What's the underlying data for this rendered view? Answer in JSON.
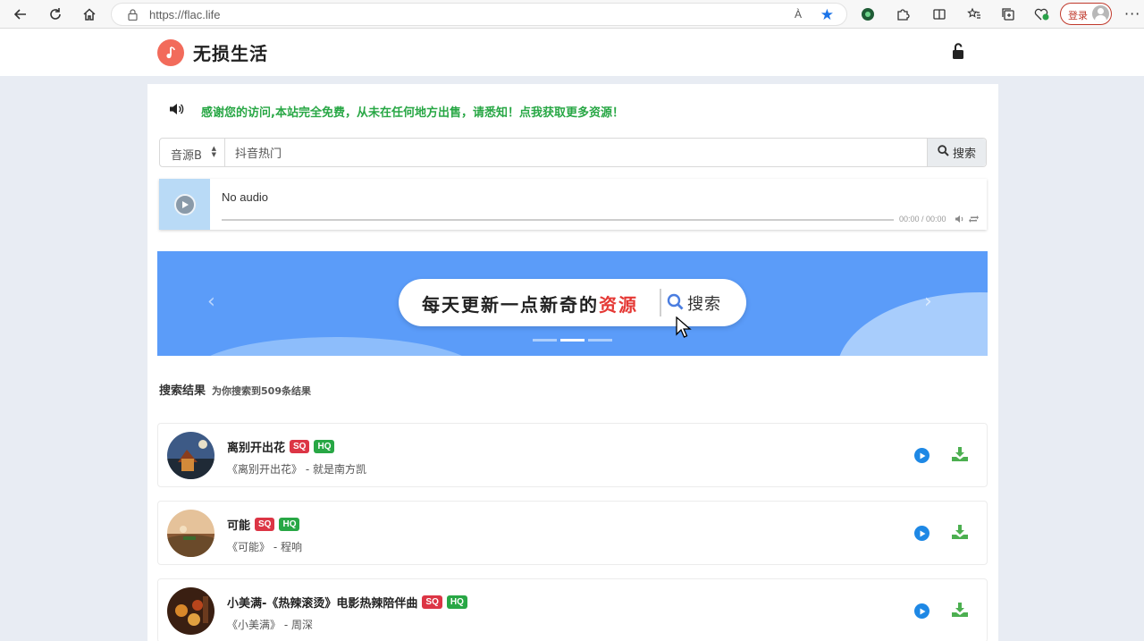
{
  "browser": {
    "url": "https://flac.life",
    "read_aloud": "À",
    "login_label": "登录"
  },
  "site": {
    "name": "无损生活"
  },
  "notice": "感谢您的访问,本站完全免费，从未在任何地方出售，请悉知！点我获取更多资源！",
  "search": {
    "source": "音源B",
    "query": "抖音热门",
    "button": "搜索"
  },
  "player": {
    "title": "No audio",
    "time": "00:00 / 00:00"
  },
  "banner": {
    "slogan_main": "每天更新一点新奇的",
    "slogan_highlight": "资源",
    "search_label": "搜索",
    "prev": "‹",
    "next": "›",
    "active_slide": 2
  },
  "results": {
    "title": "搜索结果",
    "summary": "为你搜索到509条结果",
    "items": [
      {
        "title": "离别开出花",
        "badges": [
          "SQ",
          "HQ"
        ],
        "subtitle": "《离别开出花》 - 就是南方凯"
      },
      {
        "title": "可能",
        "badges": [
          "SQ",
          "HQ"
        ],
        "subtitle": "《可能》 - 程响"
      },
      {
        "title": "小美满-《热辣滚烫》电影热辣陪伴曲",
        "badges": [
          "SQ",
          "HQ"
        ],
        "subtitle": "《小美满》 - 周深"
      }
    ]
  },
  "colors": {
    "accent_green": "#28a745",
    "badge_red": "#dc3545",
    "play_blue": "#1e88e5",
    "banner_blue": "#5b9cf9",
    "logo_coral": "#f26b5b"
  }
}
